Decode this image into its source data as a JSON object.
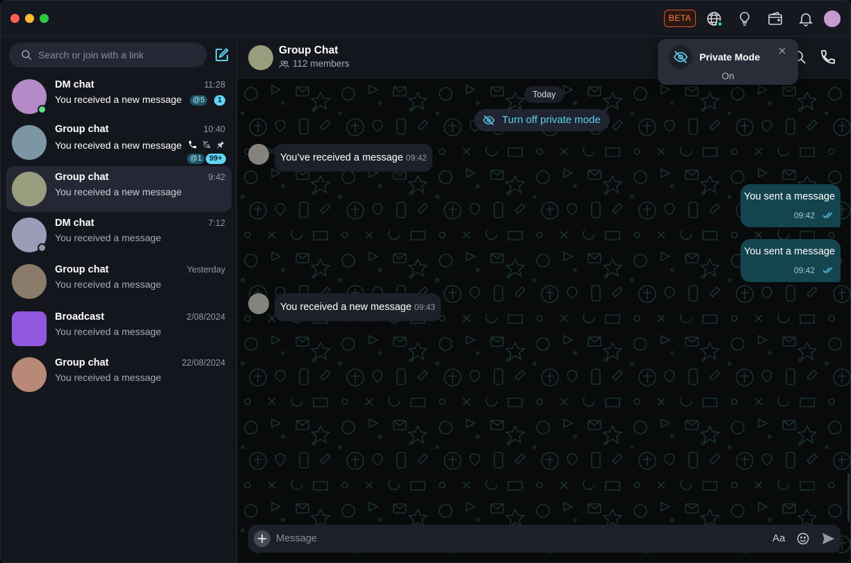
{
  "titlebar": {
    "beta_label": "BETA",
    "accent": "#e0542c"
  },
  "sidebar": {
    "search": {
      "placeholder": "Search or join with a link"
    },
    "chats": [
      {
        "name": "DM chat",
        "time": "11:28",
        "preview": "You received a new message",
        "unread": true,
        "mention_badge": "@5",
        "count_badge": "1",
        "avatar_color": "#b48bc6",
        "presence": "online"
      },
      {
        "name": "Group chat",
        "time": "10:40",
        "preview": "You received a new message",
        "unread": true,
        "mention_badge": "@1",
        "count_badge": "99+",
        "avatar_color": "#7d96a3",
        "icons": [
          "phone-icon",
          "muted-bell-icon",
          "pin-icon"
        ]
      },
      {
        "name": "Group chat",
        "time": "9:42",
        "preview": "You received a new message",
        "unread": true,
        "selected": true,
        "avatar_color": "#9a9c7e"
      },
      {
        "name": "DM chat",
        "time": "7:12",
        "preview": "You received a message",
        "avatar_color": "#9c9bb8",
        "presence": "offline"
      },
      {
        "name": "Group chat",
        "time": "Yesterday",
        "preview": "You received a message",
        "avatar_color": "#8a7b6a"
      },
      {
        "name": "Broadcast",
        "time": "2/08/2024",
        "preview": "You received a message",
        "avatar_color": "#9257df"
      },
      {
        "name": "Group chat",
        "time": "22/08/2024",
        "preview": "You received a message",
        "avatar_color": "#b88977"
      }
    ]
  },
  "chat": {
    "title": "Group Chat",
    "members": "112 members",
    "private_mode_popup": {
      "title": "Private Mode",
      "status": "On"
    },
    "day_label": "Today",
    "private_button": "Turn off private mode",
    "messages": [
      {
        "direction": "in",
        "text": "You’ve received a message",
        "time": "09:42"
      },
      {
        "direction": "out",
        "text": "You sent a message",
        "time": "09:42"
      },
      {
        "direction": "out",
        "text": "You sent a message",
        "time": "09:42"
      },
      {
        "direction": "in",
        "text": "You received a new message",
        "time": "09:43"
      }
    ],
    "composer": {
      "placeholder": "Message",
      "format_label": "Aa"
    }
  },
  "colors": {
    "accent_cyan": "#5fd0ef",
    "outgoing_bubble": "#14444e",
    "online": "#5ee08a"
  }
}
